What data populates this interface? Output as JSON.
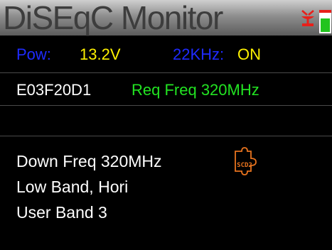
{
  "header": {
    "title": "DiSEqC  Monitor",
    "icons": {
      "antenna": "satellite-antenna-icon",
      "battery": "battery-icon"
    }
  },
  "status": {
    "power_label": "Pow:",
    "power_value": "13.2V",
    "tone_label": "22KHz:",
    "tone_value": "ON"
  },
  "command": {
    "code": "E03F20D1",
    "request": "Req Freq 320MHz"
  },
  "details": {
    "lines": [
      "Down Freq 320MHz",
      "Low Band, Hori",
      "User Band 3"
    ],
    "badge_text": "SCD2",
    "badge_icon": "scd2-puzzle-icon"
  },
  "colors": {
    "label_blue": "#1f2bff",
    "value_yellow": "#fff200",
    "request_green": "#22e322",
    "badge_orange": "#e8731e",
    "alert_red": "#e8201a",
    "battery_green": "#22c41e"
  }
}
